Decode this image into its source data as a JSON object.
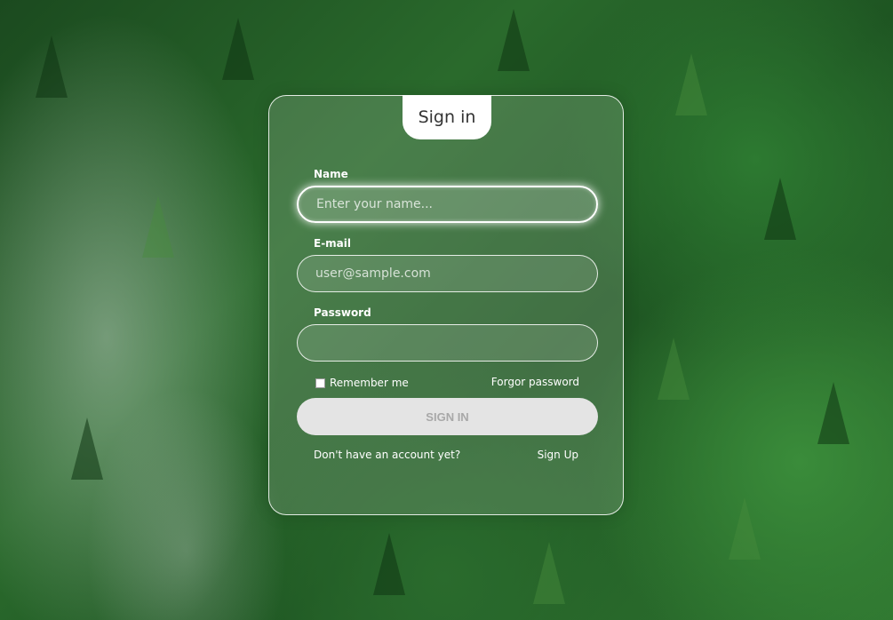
{
  "form": {
    "title": "Sign in",
    "name_label": "Name",
    "name_placeholder": "Enter your name...",
    "email_label": "E-mail",
    "email_placeholder": "user@sample.com",
    "password_label": "Password",
    "password_placeholder": "",
    "remember_label": "Remember me",
    "forgot_label": "Forgor password",
    "submit_label": "SIGN IN",
    "no_account_text": "Don't have an account yet?",
    "signup_label": "Sign Up"
  },
  "colors": {
    "card_border": "#ffffff",
    "button_bg": "#e4e4e4",
    "button_text": "#a8a8a8"
  }
}
